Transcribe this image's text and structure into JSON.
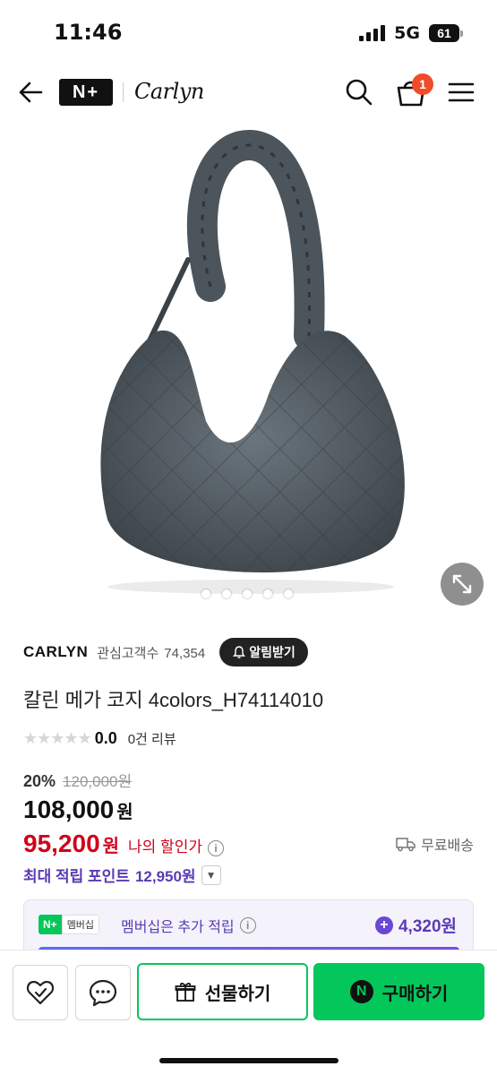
{
  "status": {
    "time": "11:46",
    "network": "5G",
    "battery": "61"
  },
  "nav": {
    "nplus": "N+",
    "brand_logo": "Carlyn",
    "cart_count": "1"
  },
  "gallery": {
    "dot_count": 5
  },
  "brand": {
    "name": "CARLYN",
    "fans_label": "관심고객수",
    "fans_count": "74,354",
    "alarm_label": "알림받기"
  },
  "product": {
    "title": "칼린 메가 코지 4colors_H74114010",
    "score": "0.0",
    "reviews": "0건 리뷰"
  },
  "pricing": {
    "discount_pct": "20%",
    "original_price": "120,000원",
    "price": "108,000",
    "price_unit": "원",
    "my_price": "95,200",
    "my_price_unit": "원",
    "my_price_label": "나의 할인가",
    "shipping": "무료배송"
  },
  "points": {
    "label": "최대 적립 포인트",
    "value": "12,950원"
  },
  "membership": {
    "tag_n": "N+",
    "tag_label": "멤버십",
    "text": "멤버십은 추가 적립",
    "value": "4,320원"
  },
  "actions": {
    "gift_label": "선물하기",
    "buy_label": "구매하기"
  },
  "colors": {
    "naver_green": "#03c75a",
    "price_red": "#d0021b",
    "points_purple": "#5a3ab5",
    "badge_orange": "#f04c28"
  }
}
